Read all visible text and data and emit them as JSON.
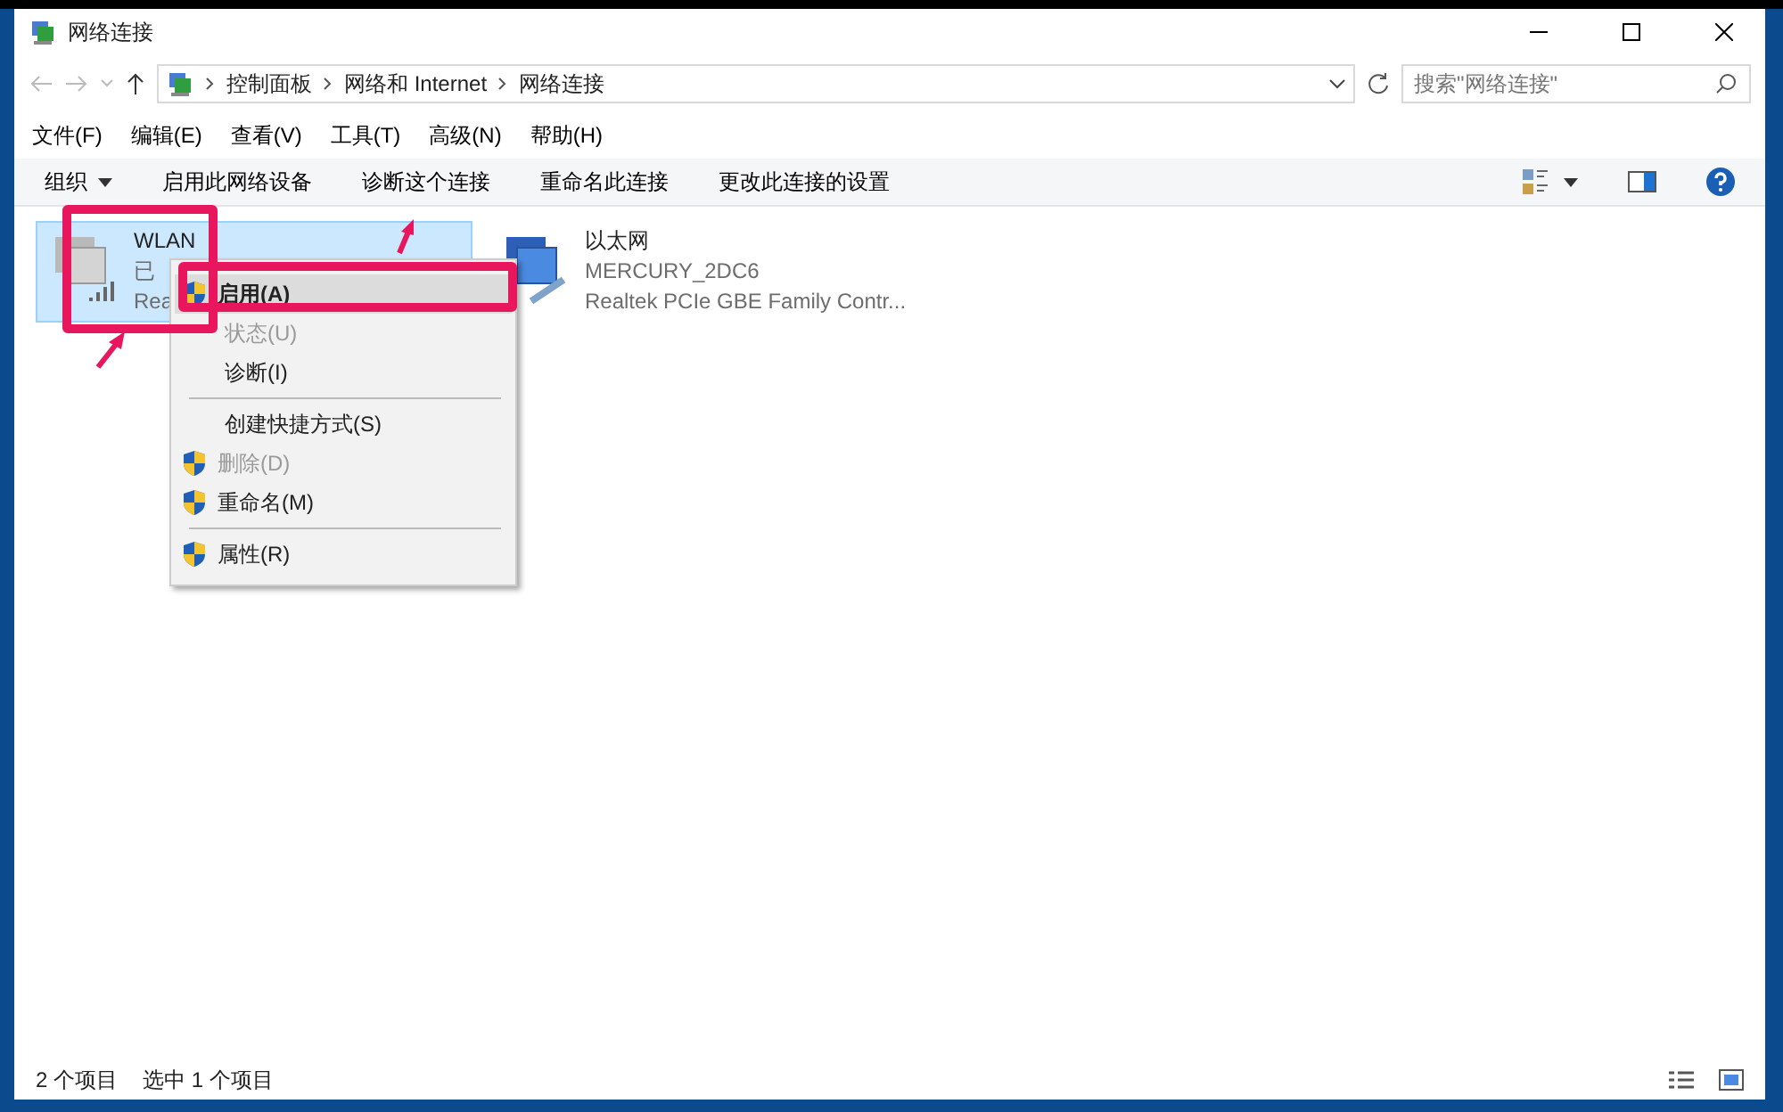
{
  "window": {
    "title": "网络连接"
  },
  "address": {
    "crumbs": [
      "控制面板",
      "网络和 Internet",
      "网络连接"
    ],
    "search_placeholder": "搜索\"网络连接\""
  },
  "menubar": [
    "文件(F)",
    "编辑(E)",
    "查看(V)",
    "工具(T)",
    "高级(N)",
    "帮助(H)"
  ],
  "toolbar": [
    {
      "label": "组织",
      "dropdown": true
    },
    {
      "label": "启用此网络设备",
      "dropdown": false
    },
    {
      "label": "诊断这个连接",
      "dropdown": false
    },
    {
      "label": "重命名此连接",
      "dropdown": false
    },
    {
      "label": "更改此连接的设置",
      "dropdown": false
    }
  ],
  "connections": [
    {
      "kind": "wifi",
      "name": "WLAN",
      "status": "已",
      "device": "Rea",
      "selected": true
    },
    {
      "kind": "wired",
      "name": "以太网",
      "status": "MERCURY_2DC6",
      "device": "Realtek PCIe GBE Family Contr...",
      "selected": false
    }
  ],
  "context_menu": [
    {
      "kind": "item",
      "label": "启用(A)",
      "shield": true,
      "disabled": false,
      "bold": true,
      "selected": true
    },
    {
      "kind": "item",
      "label": "状态(U)",
      "shield": false,
      "disabled": true,
      "bold": false,
      "selected": false
    },
    {
      "kind": "item",
      "label": "诊断(I)",
      "shield": false,
      "disabled": false,
      "bold": false,
      "selected": false
    },
    {
      "kind": "separator"
    },
    {
      "kind": "item",
      "label": "创建快捷方式(S)",
      "shield": false,
      "disabled": false,
      "bold": false,
      "selected": false
    },
    {
      "kind": "item",
      "label": "删除(D)",
      "shield": true,
      "disabled": true,
      "bold": false,
      "selected": false
    },
    {
      "kind": "item",
      "label": "重命名(M)",
      "shield": true,
      "disabled": false,
      "bold": false,
      "selected": false
    },
    {
      "kind": "separator"
    },
    {
      "kind": "item",
      "label": "属性(R)",
      "shield": true,
      "disabled": false,
      "bold": false,
      "selected": false
    }
  ],
  "status_bar": [
    "2 个项目",
    "选中 1 个项目"
  ]
}
